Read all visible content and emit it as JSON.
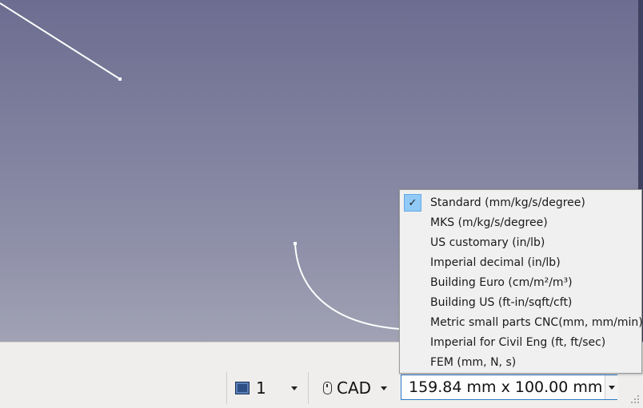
{
  "status_bar": {
    "page_number": "1",
    "navigation_style": "CAD",
    "dimensions": "159.84 mm x 100.00 mm"
  },
  "unit_menu": {
    "items": [
      {
        "label": "Standard (mm/kg/s/degree)",
        "checked": true
      },
      {
        "label": "MKS (m/kg/s/degree)",
        "checked": false
      },
      {
        "label": "US customary (in/lb)",
        "checked": false
      },
      {
        "label": "Imperial decimal (in/lb)",
        "checked": false
      },
      {
        "label": "Building Euro (cm/m²/m³)",
        "checked": false
      },
      {
        "label": "Building US (ft-in/sqft/cft)",
        "checked": false
      },
      {
        "label": "Metric small parts  CNC(mm, mm/min)",
        "checked": false
      },
      {
        "label": "Imperial for Civil Eng (ft, ft/sec)",
        "checked": false
      },
      {
        "label": "FEM (mm, N, s)",
        "checked": false
      }
    ],
    "check_glyph": "✓"
  },
  "colors": {
    "viewport_top": "#6c6d90",
    "viewport_bottom": "#a1a2b4",
    "selection_highlight": "#91c9f7",
    "focus_border": "#2a78c8"
  }
}
